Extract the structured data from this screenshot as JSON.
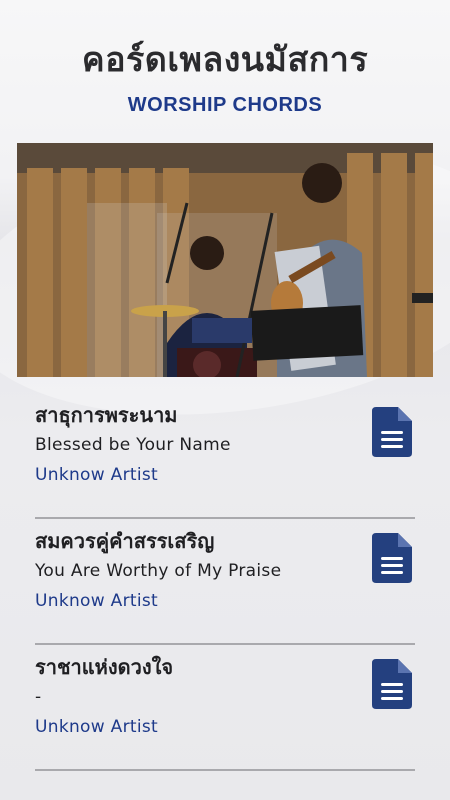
{
  "header": {
    "title": "คอร์ดเพลงนมัสการ",
    "subtitle": "WORSHIP CHORDS"
  },
  "hero": {
    "image_desc": "worship band photo"
  },
  "songs": [
    {
      "title": "สาธุการพระนาม",
      "subtitle": "Blessed be Your Name",
      "artist": "Unknow Artist",
      "icon": "document-icon"
    },
    {
      "title": "สมควรคู่คำสรรเสริญ",
      "subtitle": "You Are Worthy of My Praise",
      "artist": "Unknow Artist",
      "icon": "document-icon"
    },
    {
      "title": "ราชาแห่งดวงใจ",
      "subtitle": "-",
      "artist": "Unknow Artist",
      "icon": "document-icon"
    }
  ],
  "colors": {
    "accent": "#1e3a8a",
    "icon": "#24407f"
  }
}
